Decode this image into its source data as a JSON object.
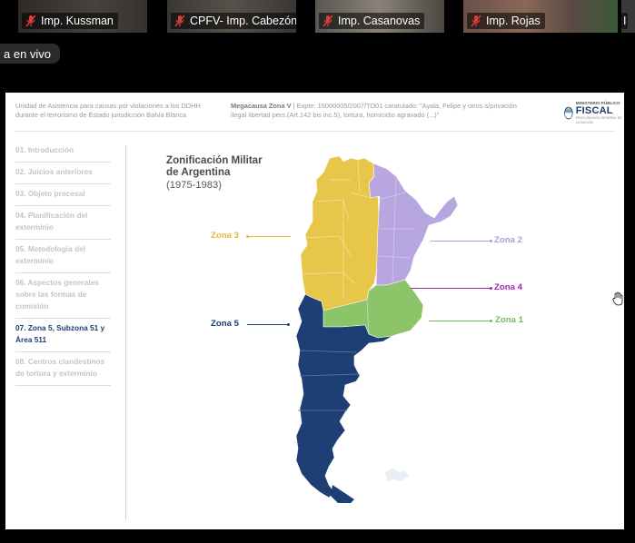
{
  "participants": [
    {
      "name": "Imp. Kussman",
      "bg": "#35322f"
    },
    {
      "name": "CPFV- Imp. Cabezón",
      "bg": "#3d3a36"
    },
    {
      "name": "Imp. Casanovas",
      "bg": "#4a4744"
    },
    {
      "name": "Imp. Rojas",
      "bg": "#5a4a44"
    },
    {
      "name": "I",
      "bg": "#3a3a3a"
    }
  ],
  "live_label": "a en vivo",
  "slide": {
    "header_left": "Unidad de Asistencia para causas por violaciones a los DDHH durante el terrorismo de Estado jurisdicción Bahía Blanca",
    "header_right_bold": "Megacausa Zona V",
    "header_right_text": " | Expte: 15000005/2007/TO01 caratulado: \"Ayala, Felipe y otros s/privación ilegal libertad pers.(Art.142 bis inc.5), tortura, homicidio agravado (...)\"",
    "logo_top": "MINISTERIO PÚBLICO",
    "logo_main": "FISCAL",
    "logo_bottom": "PROCURACIÓN GENERAL DE LA NACIÓN",
    "menu": [
      {
        "label": "01. Introducción",
        "active": false
      },
      {
        "label": "02. Juicios anteriores",
        "active": false
      },
      {
        "label": "03. Objeto procesal",
        "active": false
      },
      {
        "label": "04. Planificación del exterminio",
        "active": false
      },
      {
        "label": "05. Metodología del exterminio",
        "active": false
      },
      {
        "label": "06. Aspectos generales sobre las formas de comisión",
        "active": false
      },
      {
        "label": "07. Zona 5, Subzona 51 y Área 511",
        "active": true
      },
      {
        "label": "08. Centros clandestinos de tortura y exterminio",
        "active": false
      }
    ],
    "map_title_line1": "Zonificación Militar",
    "map_title_line2": "de Argentina",
    "map_subtitle": "(1975-1983)",
    "zones": [
      {
        "label": "Zona 3",
        "color": "#e8c64a"
      },
      {
        "label": "Zona 2",
        "color": "#b8a6e0"
      },
      {
        "label": "Zona 4",
        "color": "#b12ac0"
      },
      {
        "label": "Zona 1",
        "color": "#8cc46a"
      },
      {
        "label": "Zona 5",
        "color": "#1e3f73"
      }
    ]
  }
}
